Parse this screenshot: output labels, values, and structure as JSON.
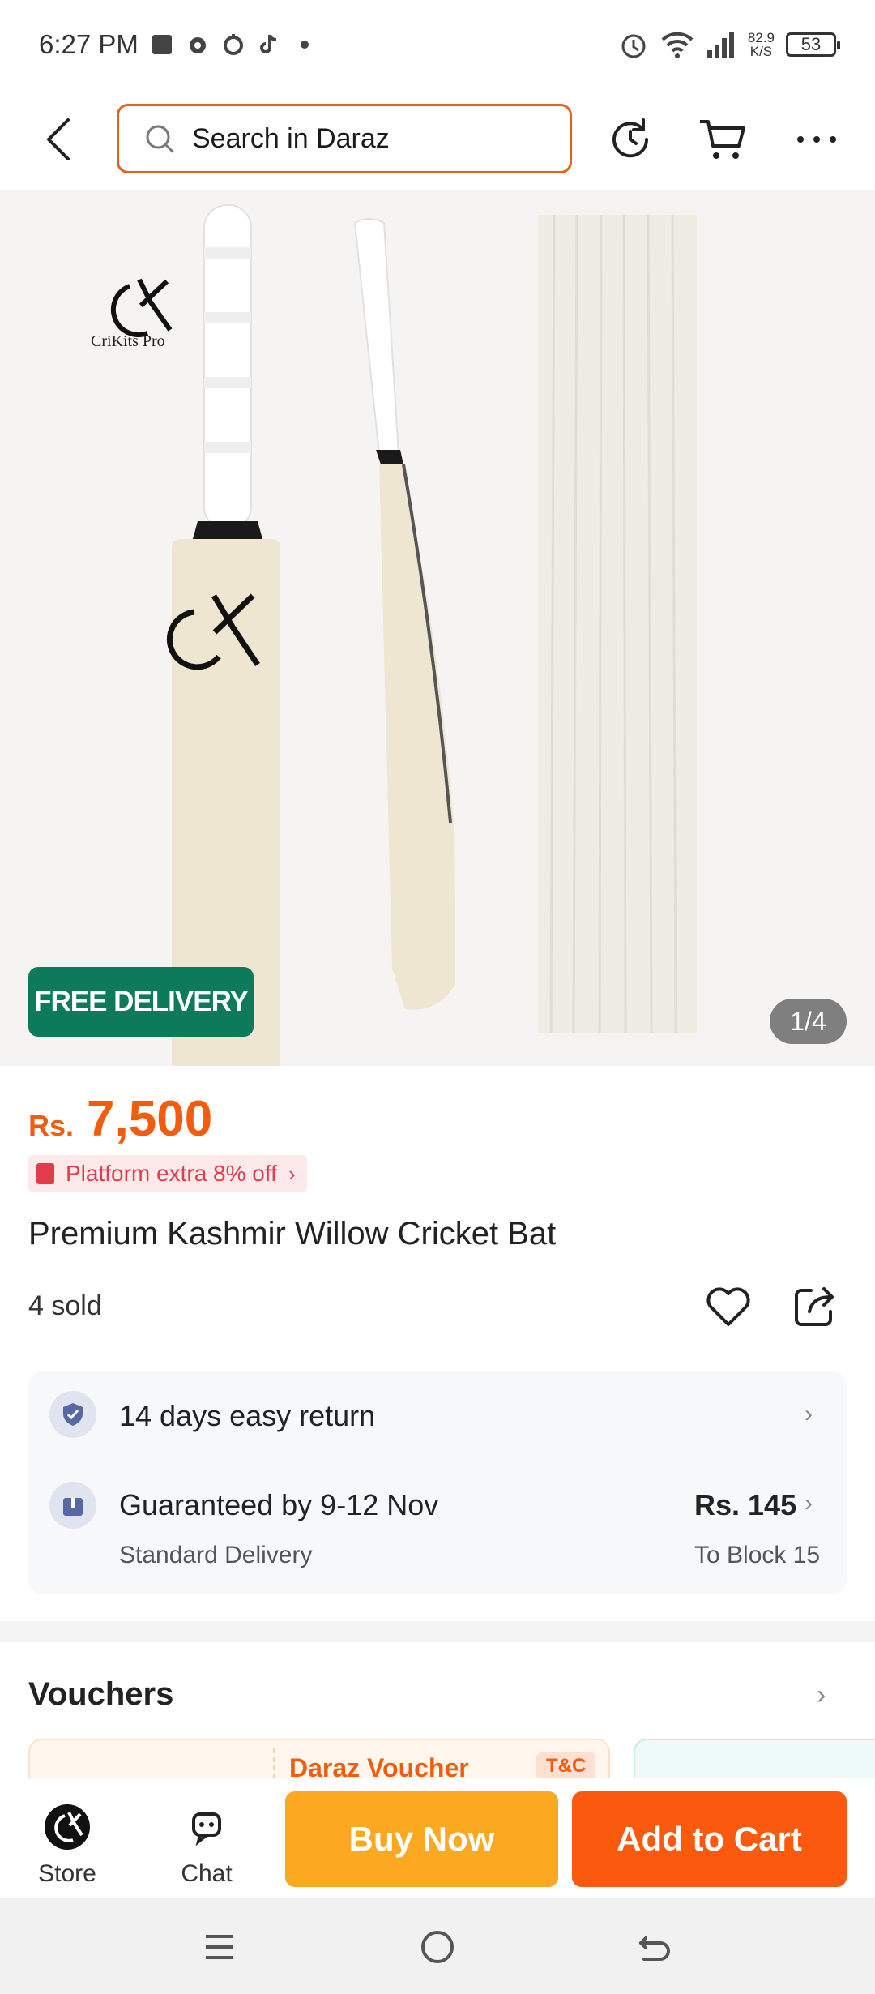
{
  "status_bar": {
    "time": "6:27 PM",
    "net_speed_value": "82.9",
    "net_speed_unit": "K/S",
    "battery": "53"
  },
  "top_nav": {
    "search_placeholder": "Search in Daraz"
  },
  "gallery": {
    "brand_name": "CriKits Pro",
    "free_delivery_badge": "FREE DELIVERY",
    "page_indicator": "1/4"
  },
  "product": {
    "currency": "Rs.",
    "price": "7,500",
    "promo": "Platform extra 8% off",
    "title": "Premium Kashmir Willow Cricket Bat",
    "sold": "4 sold"
  },
  "services": {
    "return_label": "14 days easy return",
    "delivery_label": "Guaranteed by 9-12 Nov",
    "delivery_sub": "Standard Delivery",
    "delivery_price": "Rs. 145",
    "delivery_location": "To Block 15"
  },
  "vouchers": {
    "section_title": "Vouchers",
    "card_title": "Daraz Voucher",
    "card_tag": "T&C"
  },
  "action_bar": {
    "store_label": "Store",
    "chat_label": "Chat",
    "buy_now_label": "Buy Now",
    "add_to_cart_label": "Add to Cart"
  },
  "colors": {
    "accent_orange": "#f25c0c",
    "buy_now": "#fca821",
    "add_to_cart": "#fb5a0e",
    "free_delivery": "#0c7a5b"
  }
}
